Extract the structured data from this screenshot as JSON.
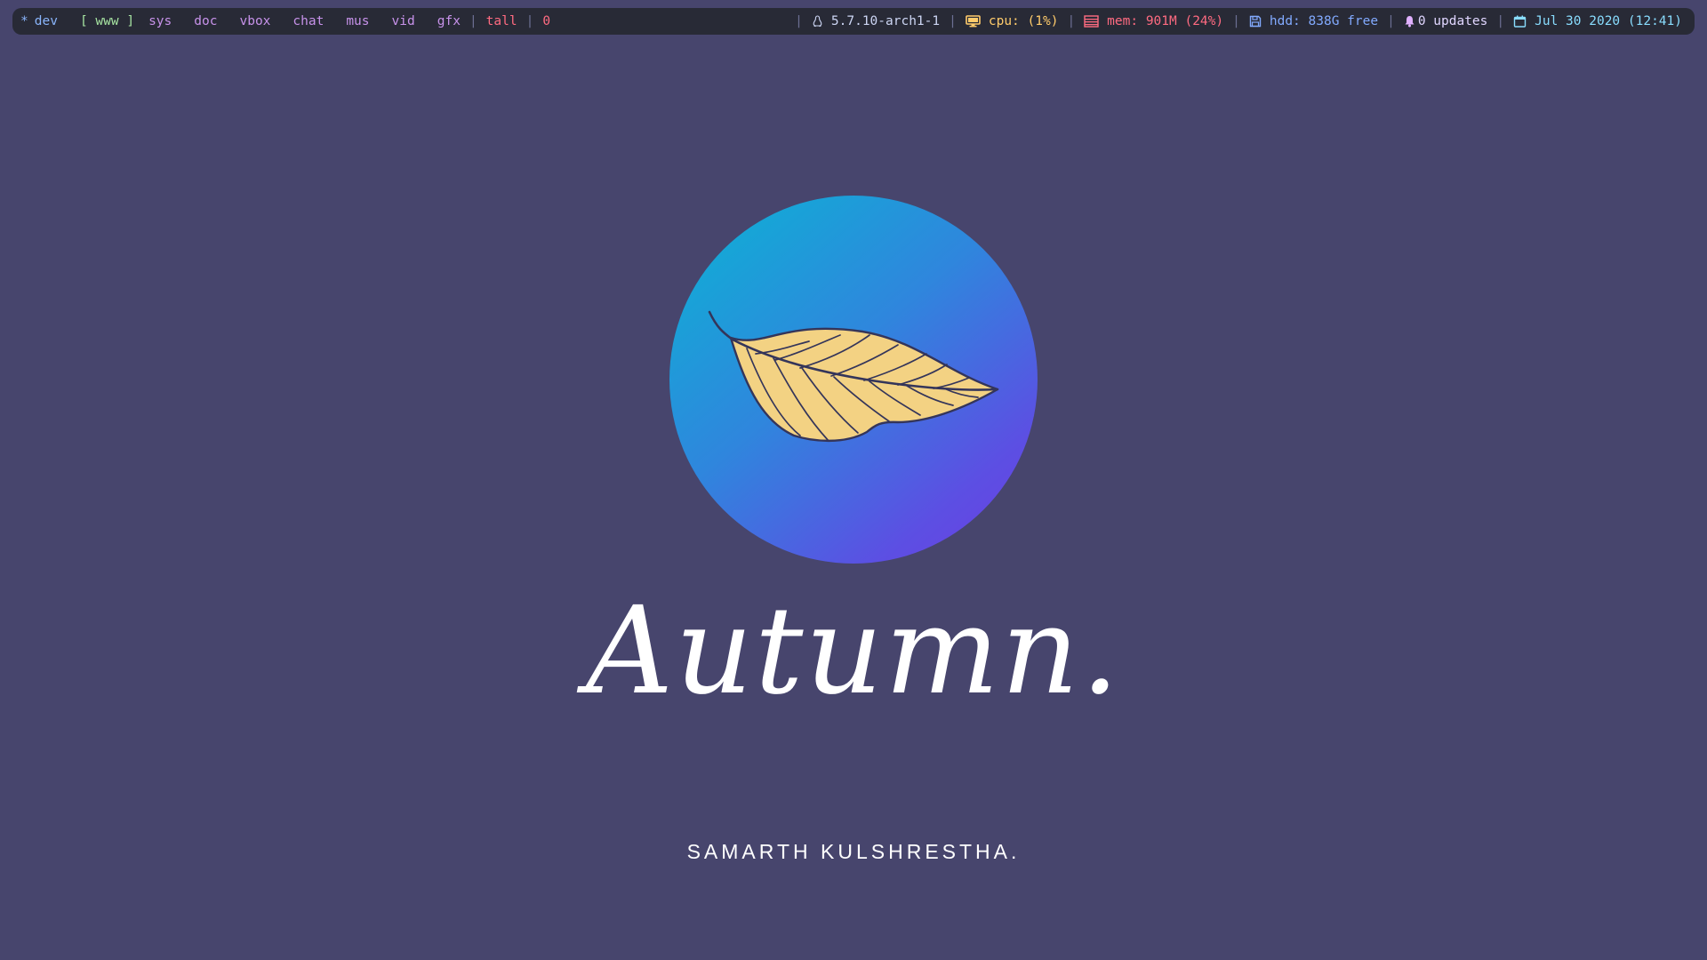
{
  "statusbar": {
    "workspaces": [
      {
        "label": "dev"
      },
      {
        "label": "www",
        "current": true
      },
      {
        "label": "sys"
      },
      {
        "label": "doc"
      },
      {
        "label": "vbox"
      },
      {
        "label": "chat"
      },
      {
        "label": "mus"
      },
      {
        "label": "vid"
      },
      {
        "label": "gfx"
      }
    ],
    "current_open": "[",
    "current_close": "]",
    "layout": "tall",
    "window_count": "0",
    "kernel": "5.7.10-arch1-1",
    "cpu": "cpu: (1%)",
    "mem": "mem: 901M (24%)",
    "hdd": "hdd: 838G free",
    "updates": "0 updates",
    "datetime": "Jul 30 2020 (12:41)",
    "separator": "|"
  },
  "wallpaper": {
    "title": "Autumn.",
    "author": "SAMARTH KULSHRESTHA.",
    "icon": "leaf-icon",
    "colors": {
      "background": "#47456d",
      "circle_start": "#0bb4d4",
      "circle_end": "#6d3ce2",
      "leaf_fill": "#f3d283",
      "leaf_stroke": "#34355a"
    }
  }
}
